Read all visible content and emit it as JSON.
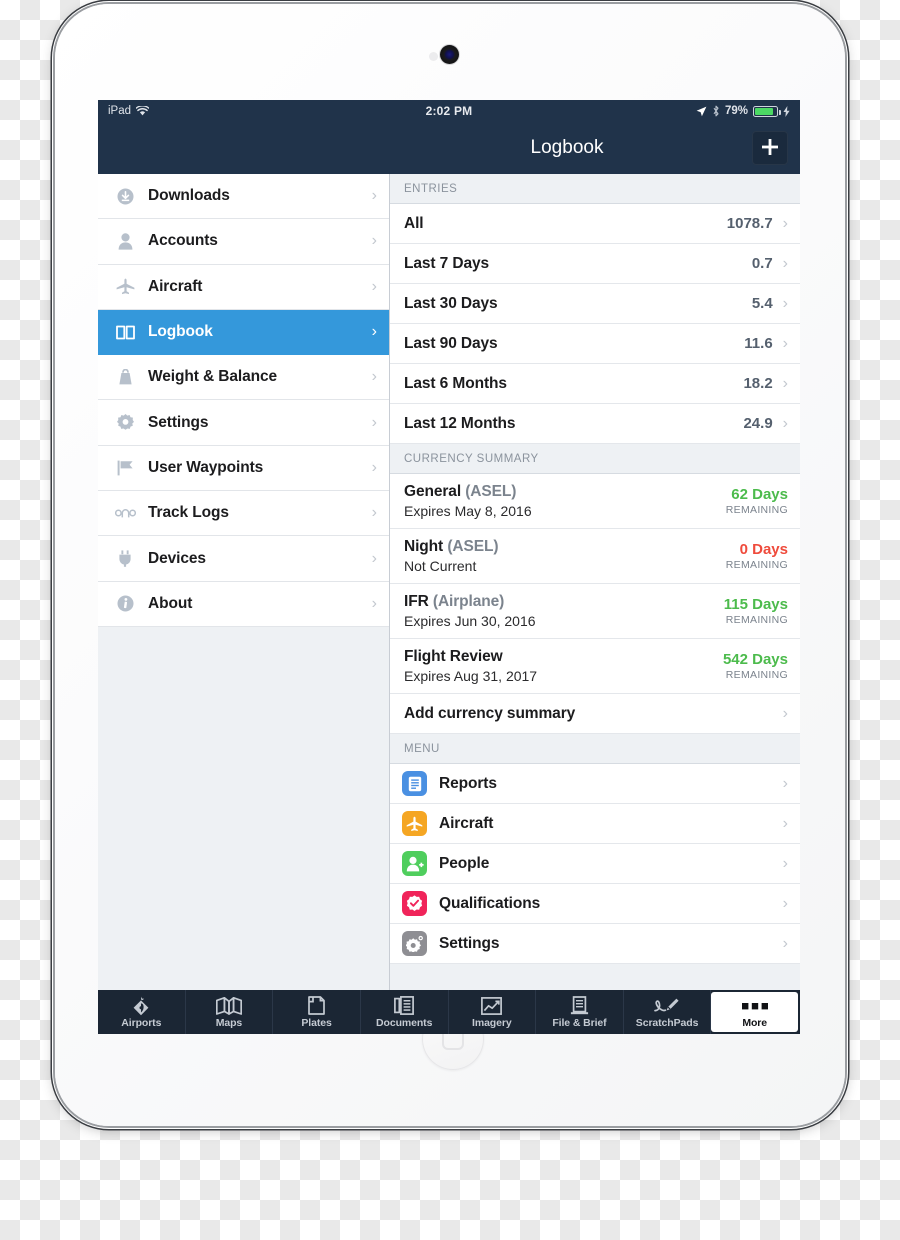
{
  "status_bar": {
    "device": "iPad",
    "wifi_icon": "wifi-icon",
    "time": "2:02 PM",
    "location_icon": "location-arrow-icon",
    "bluetooth_icon": "bluetooth-icon",
    "battery_percent": "79%",
    "battery_level": 79,
    "charging_icon": "lightning-bolt-icon"
  },
  "nav_bar": {
    "title": "Logbook",
    "add_label": "+"
  },
  "sidebar": {
    "items": [
      {
        "label": "Downloads",
        "icon": "download-circle-icon",
        "active": false
      },
      {
        "label": "Accounts",
        "icon": "person-icon",
        "active": false
      },
      {
        "label": "Aircraft",
        "icon": "airplane-icon",
        "active": false
      },
      {
        "label": "Logbook",
        "icon": "open-book-icon",
        "active": true
      },
      {
        "label": "Weight & Balance",
        "icon": "weight-icon",
        "active": false
      },
      {
        "label": "Settings",
        "icon": "gear-icon",
        "active": false
      },
      {
        "label": "User Waypoints",
        "icon": "flag-icon",
        "active": false
      },
      {
        "label": "Track Logs",
        "icon": "track-log-icon",
        "active": false
      },
      {
        "label": "Devices",
        "icon": "plug-icon",
        "active": false
      },
      {
        "label": "About",
        "icon": "info-icon",
        "active": false
      }
    ]
  },
  "detail": {
    "entries": {
      "header": "ENTRIES",
      "rows": [
        {
          "label": "All",
          "value": "1078.7"
        },
        {
          "label": "Last 7 Days",
          "value": "0.7"
        },
        {
          "label": "Last 30 Days",
          "value": "5.4"
        },
        {
          "label": "Last 90 Days",
          "value": "11.6"
        },
        {
          "label": "Last 6 Months",
          "value": "18.2"
        },
        {
          "label": "Last 12 Months",
          "value": "24.9"
        }
      ]
    },
    "currency": {
      "header": "CURRENCY SUMMARY",
      "remaining_label": "REMAINING",
      "rows": [
        {
          "name": "General",
          "category": "(ASEL)",
          "sub": "Expires May 8, 2016",
          "days": "62 Days",
          "state": "ok"
        },
        {
          "name": "Night",
          "category": "(ASEL)",
          "sub": "Not Current",
          "days": "0 Days",
          "state": "bad"
        },
        {
          "name": "IFR",
          "category": "(Airplane)",
          "sub": "Expires Jun 30, 2016",
          "days": "115 Days",
          "state": "ok"
        },
        {
          "name": "Flight Review",
          "category": "",
          "sub": "Expires Aug 31, 2017",
          "days": "542 Days",
          "state": "ok"
        }
      ],
      "add_label": "Add currency summary"
    },
    "menu": {
      "header": "MENU",
      "rows": [
        {
          "label": "Reports",
          "icon": "report-document-icon",
          "color": "#4a90e2"
        },
        {
          "label": "Aircraft",
          "icon": "airplane-icon",
          "color": "#f5a623"
        },
        {
          "label": "People",
          "icon": "person-add-icon",
          "color": "#4fce5d"
        },
        {
          "label": "Qualifications",
          "icon": "check-badge-icon",
          "color": "#f0245a"
        },
        {
          "label": "Settings",
          "icon": "gear-icon",
          "color": "#8e8e93"
        }
      ]
    }
  },
  "tab_bar": {
    "tabs": [
      {
        "label": "Airports",
        "icon": "airport-beacon-icon",
        "active": false
      },
      {
        "label": "Maps",
        "icon": "folded-map-icon",
        "active": false
      },
      {
        "label": "Plates",
        "icon": "plate-page-icon",
        "active": false
      },
      {
        "label": "Documents",
        "icon": "documents-icon",
        "active": false
      },
      {
        "label": "Imagery",
        "icon": "chart-imagery-icon",
        "active": false
      },
      {
        "label": "File & Brief",
        "icon": "file-brief-icon",
        "active": false
      },
      {
        "label": "ScratchPads",
        "icon": "pencil-scratch-icon",
        "active": false
      },
      {
        "label": "More",
        "icon": "ellipsis-icon",
        "active": true
      }
    ]
  },
  "theme": {
    "nav_bar_color": "#20334a",
    "tab_bar_color": "#1b2634",
    "accent_color": "#3498db",
    "ok_color": "#4cbb4c",
    "bad_color": "#ef4b3c",
    "sidebar_bg_color": "#eef1f4"
  }
}
